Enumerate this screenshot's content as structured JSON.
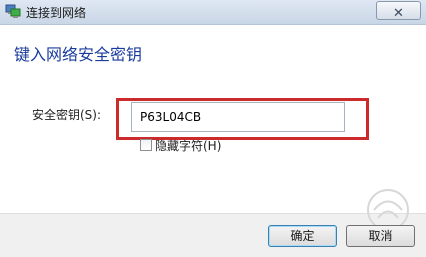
{
  "window": {
    "title": "连接到网络",
    "icon": "network-connect-icon",
    "close_glyph": "✕"
  },
  "heading": "键入网络安全密钥",
  "form": {
    "key_label": "安全密钥(S):",
    "key_value": "P63L04CB",
    "hide_label": "隐藏字符(H)",
    "hide_checked": false
  },
  "buttons": {
    "ok": "确定",
    "cancel": "取消"
  },
  "colors": {
    "heading": "#1a3c9c",
    "highlight": "#cc2b2b",
    "footer": "#f0f0f0"
  }
}
